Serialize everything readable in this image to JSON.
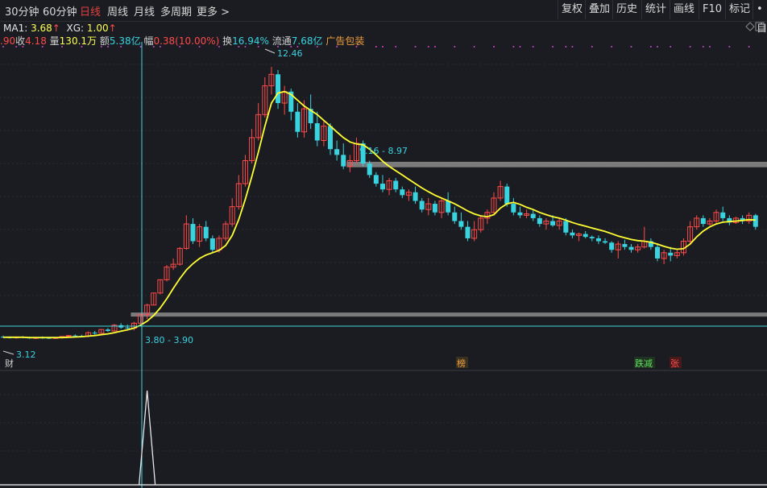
{
  "toolbar": {
    "periods": [
      "30分钟",
      "60分钟",
      "日线",
      "周线",
      "月线",
      "多周期",
      "更多 >"
    ],
    "active_period": "日线",
    "tools": [
      "复权",
      "叠加",
      "历史",
      "统计",
      "画线",
      "F10",
      "标记",
      "•自"
    ]
  },
  "indicator": {
    "ma_label": "MA1:",
    "ma_value": "3.68",
    "ma_arrow": "↑",
    "xg_label": "XG:",
    "xg_value": "1.00",
    "xg_arrow": "↑"
  },
  "quote": {
    "open_fragment": ".90",
    "close_label": "收",
    "close_value": "4.18",
    "volume_label": "量",
    "volume_value": "130.1万",
    "amount_label": "额",
    "amount_value": "5.38亿",
    "change_label": "幅",
    "change_value": "0.38(10.00%)",
    "turnover_label": "换",
    "turnover_value": "16.94%",
    "float_label": "流通",
    "float_value": "7.68亿",
    "ad_label": "广告包装"
  },
  "annotations": {
    "high_label": "12.46",
    "low_label": "3.12",
    "range_upper": "9.16 - 8.97",
    "range_lower": "3.80 - 3.90",
    "tag_cai": "财",
    "tag_bang": "榜",
    "tag_jianchi": "跌减",
    "tag_zhang": "张"
  },
  "colors": {
    "background": "#1b1c21",
    "up_candle": "#ff4a4a",
    "down_candle": "#39d3e0",
    "ma_line": "#ffff33",
    "range_band": "#8c8c8c",
    "crosshair": "#3fd6e0",
    "active_tab": "#e04040"
  },
  "chart_data": {
    "type": "candlestick",
    "indicator_line": "MA1",
    "price_range": [
      2.3,
      13.3
    ],
    "high": 12.46,
    "low": 3.12,
    "candles": [
      {
        "o": 3.08,
        "h": 3.12,
        "l": 3.03,
        "c": 3.06
      },
      {
        "o": 3.06,
        "h": 3.09,
        "l": 3.02,
        "c": 3.05
      },
      {
        "o": 3.05,
        "h": 3.09,
        "l": 3.01,
        "c": 3.07
      },
      {
        "o": 3.07,
        "h": 3.1,
        "l": 3.03,
        "c": 3.05
      },
      {
        "o": 3.05,
        "h": 3.08,
        "l": 3.01,
        "c": 3.03
      },
      {
        "o": 3.03,
        "h": 3.07,
        "l": 3.0,
        "c": 3.05
      },
      {
        "o": 3.05,
        "h": 3.09,
        "l": 3.01,
        "c": 3.04
      },
      {
        "o": 3.04,
        "h": 3.07,
        "l": 3.0,
        "c": 3.03
      },
      {
        "o": 3.03,
        "h": 3.06,
        "l": 3.0,
        "c": 3.05
      },
      {
        "o": 3.05,
        "h": 3.1,
        "l": 3.02,
        "c": 3.09
      },
      {
        "o": 3.09,
        "h": 3.14,
        "l": 3.05,
        "c": 3.12
      },
      {
        "o": 3.12,
        "h": 3.16,
        "l": 3.08,
        "c": 3.11
      },
      {
        "o": 3.11,
        "h": 3.15,
        "l": 3.06,
        "c": 3.1
      },
      {
        "o": 3.1,
        "h": 3.26,
        "l": 3.06,
        "c": 3.22
      },
      {
        "o": 3.22,
        "h": 3.28,
        "l": 3.15,
        "c": 3.2
      },
      {
        "o": 3.2,
        "h": 3.35,
        "l": 3.18,
        "c": 3.33
      },
      {
        "o": 3.33,
        "h": 3.38,
        "l": 3.25,
        "c": 3.28
      },
      {
        "o": 3.28,
        "h": 3.52,
        "l": 3.26,
        "c": 3.48
      },
      {
        "o": 3.48,
        "h": 3.55,
        "l": 3.35,
        "c": 3.4
      },
      {
        "o": 3.4,
        "h": 3.5,
        "l": 3.33,
        "c": 3.38
      },
      {
        "o": 3.38,
        "h": 3.6,
        "l": 3.3,
        "c": 3.55
      },
      {
        "o": 3.55,
        "h": 3.9,
        "l": 3.52,
        "c": 3.85
      },
      {
        "o": 3.85,
        "h": 4.23,
        "l": 3.7,
        "c": 4.18
      },
      {
        "o": 4.18,
        "h": 4.6,
        "l": 4.18,
        "c": 4.6
      },
      {
        "o": 4.6,
        "h": 5.06,
        "l": 4.55,
        "c": 5.06
      },
      {
        "o": 5.06,
        "h": 5.57,
        "l": 5.0,
        "c": 5.5
      },
      {
        "o": 5.5,
        "h": 5.8,
        "l": 5.4,
        "c": 5.6
      },
      {
        "o": 5.6,
        "h": 6.2,
        "l": 5.55,
        "c": 6.15
      },
      {
        "o": 6.15,
        "h": 7.3,
        "l": 6.1,
        "c": 7.0
      },
      {
        "o": 7.0,
        "h": 7.2,
        "l": 6.3,
        "c": 6.4
      },
      {
        "o": 6.4,
        "h": 7.0,
        "l": 6.2,
        "c": 6.9
      },
      {
        "o": 6.9,
        "h": 7.1,
        "l": 6.4,
        "c": 6.5
      },
      {
        "o": 6.5,
        "h": 6.6,
        "l": 6.0,
        "c": 6.1
      },
      {
        "o": 6.1,
        "h": 6.6,
        "l": 6.0,
        "c": 6.5
      },
      {
        "o": 6.5,
        "h": 7.1,
        "l": 6.4,
        "c": 7.0
      },
      {
        "o": 7.0,
        "h": 7.9,
        "l": 6.9,
        "c": 7.6
      },
      {
        "o": 7.6,
        "h": 8.7,
        "l": 7.5,
        "c": 8.4
      },
      {
        "o": 8.4,
        "h": 9.4,
        "l": 8.3,
        "c": 9.2
      },
      {
        "o": 9.2,
        "h": 10.3,
        "l": 9.1,
        "c": 10.0
      },
      {
        "o": 10.0,
        "h": 11.2,
        "l": 9.9,
        "c": 10.8
      },
      {
        "o": 10.8,
        "h": 12.1,
        "l": 10.7,
        "c": 11.8
      },
      {
        "o": 11.8,
        "h": 12.46,
        "l": 11.5,
        "c": 12.2
      },
      {
        "o": 12.2,
        "h": 12.35,
        "l": 11.0,
        "c": 11.2
      },
      {
        "o": 11.2,
        "h": 11.8,
        "l": 10.8,
        "c": 11.6
      },
      {
        "o": 11.6,
        "h": 11.7,
        "l": 10.6,
        "c": 10.9
      },
      {
        "o": 10.9,
        "h": 11.2,
        "l": 10.0,
        "c": 10.2
      },
      {
        "o": 10.2,
        "h": 11.3,
        "l": 10.0,
        "c": 11.0
      },
      {
        "o": 11.0,
        "h": 11.5,
        "l": 10.3,
        "c": 10.5
      },
      {
        "o": 10.5,
        "h": 10.9,
        "l": 9.7,
        "c": 9.9
      },
      {
        "o": 9.9,
        "h": 10.6,
        "l": 9.7,
        "c": 10.4
      },
      {
        "o": 10.4,
        "h": 10.5,
        "l": 9.4,
        "c": 9.6
      },
      {
        "o": 9.6,
        "h": 9.9,
        "l": 9.2,
        "c": 9.4
      },
      {
        "o": 9.4,
        "h": 9.8,
        "l": 8.9,
        "c": 9.0
      },
      {
        "o": 9.0,
        "h": 9.4,
        "l": 8.8,
        "c": 9.2
      },
      {
        "o": 9.2,
        "h": 10.0,
        "l": 9.1,
        "c": 9.8
      },
      {
        "o": 9.8,
        "h": 9.9,
        "l": 9.0,
        "c": 9.1
      },
      {
        "o": 9.1,
        "h": 9.2,
        "l": 8.6,
        "c": 8.7
      },
      {
        "o": 8.7,
        "h": 8.8,
        "l": 8.3,
        "c": 8.4
      },
      {
        "o": 8.4,
        "h": 8.7,
        "l": 8.1,
        "c": 8.2
      },
      {
        "o": 8.2,
        "h": 8.6,
        "l": 8.0,
        "c": 8.5
      },
      {
        "o": 8.5,
        "h": 8.6,
        "l": 8.1,
        "c": 8.2
      },
      {
        "o": 8.2,
        "h": 8.3,
        "l": 7.9,
        "c": 8.0
      },
      {
        "o": 8.0,
        "h": 8.2,
        "l": 7.8,
        "c": 8.1
      },
      {
        "o": 8.1,
        "h": 8.3,
        "l": 7.7,
        "c": 7.8
      },
      {
        "o": 7.8,
        "h": 7.9,
        "l": 7.4,
        "c": 7.5
      },
      {
        "o": 7.5,
        "h": 7.9,
        "l": 7.3,
        "c": 7.7
      },
      {
        "o": 7.7,
        "h": 7.8,
        "l": 7.3,
        "c": 7.4
      },
      {
        "o": 7.4,
        "h": 7.9,
        "l": 7.2,
        "c": 7.8
      },
      {
        "o": 7.8,
        "h": 8.1,
        "l": 7.3,
        "c": 7.4
      },
      {
        "o": 7.4,
        "h": 7.6,
        "l": 7.0,
        "c": 7.1
      },
      {
        "o": 7.1,
        "h": 7.4,
        "l": 6.8,
        "c": 6.9
      },
      {
        "o": 6.9,
        "h": 7.1,
        "l": 6.4,
        "c": 6.5
      },
      {
        "o": 6.5,
        "h": 7.1,
        "l": 6.4,
        "c": 6.8
      },
      {
        "o": 6.8,
        "h": 7.3,
        "l": 6.7,
        "c": 7.2
      },
      {
        "o": 7.2,
        "h": 7.5,
        "l": 7.0,
        "c": 7.4
      },
      {
        "o": 7.4,
        "h": 8.1,
        "l": 7.3,
        "c": 7.9
      },
      {
        "o": 7.9,
        "h": 8.5,
        "l": 7.8,
        "c": 8.3
      },
      {
        "o": 8.3,
        "h": 8.4,
        "l": 7.6,
        "c": 7.7
      },
      {
        "o": 7.7,
        "h": 7.9,
        "l": 7.3,
        "c": 7.4
      },
      {
        "o": 7.4,
        "h": 7.6,
        "l": 7.2,
        "c": 7.3
      },
      {
        "o": 7.3,
        "h": 7.5,
        "l": 7.2,
        "c": 7.35
      },
      {
        "o": 7.35,
        "h": 7.5,
        "l": 7.1,
        "c": 7.2
      },
      {
        "o": 7.2,
        "h": 7.3,
        "l": 6.9,
        "c": 7.0
      },
      {
        "o": 7.0,
        "h": 7.2,
        "l": 6.8,
        "c": 7.1
      },
      {
        "o": 7.1,
        "h": 7.3,
        "l": 6.9,
        "c": 6.95
      },
      {
        "o": 6.95,
        "h": 7.2,
        "l": 6.8,
        "c": 7.1
      },
      {
        "o": 7.1,
        "h": 7.2,
        "l": 6.6,
        "c": 6.7
      },
      {
        "o": 6.7,
        "h": 6.8,
        "l": 6.5,
        "c": 6.6
      },
      {
        "o": 6.6,
        "h": 6.7,
        "l": 6.4,
        "c": 6.65
      },
      {
        "o": 6.65,
        "h": 6.75,
        "l": 6.5,
        "c": 6.55
      },
      {
        "o": 6.55,
        "h": 6.6,
        "l": 6.4,
        "c": 6.5
      },
      {
        "o": 6.5,
        "h": 6.6,
        "l": 6.3,
        "c": 6.4
      },
      {
        "o": 6.4,
        "h": 6.5,
        "l": 6.3,
        "c": 6.35
      },
      {
        "o": 6.35,
        "h": 6.4,
        "l": 6.0,
        "c": 6.1
      },
      {
        "o": 6.1,
        "h": 6.4,
        "l": 5.8,
        "c": 6.3
      },
      {
        "o": 6.3,
        "h": 6.45,
        "l": 6.1,
        "c": 6.2
      },
      {
        "o": 6.2,
        "h": 6.3,
        "l": 6.0,
        "c": 6.1
      },
      {
        "o": 6.1,
        "h": 6.3,
        "l": 6.0,
        "c": 6.2
      },
      {
        "o": 6.2,
        "h": 6.9,
        "l": 6.15,
        "c": 6.4
      },
      {
        "o": 6.4,
        "h": 6.5,
        "l": 6.1,
        "c": 6.2
      },
      {
        "o": 6.2,
        "h": 6.3,
        "l": 5.7,
        "c": 5.8
      },
      {
        "o": 5.8,
        "h": 6.1,
        "l": 5.6,
        "c": 6.0
      },
      {
        "o": 6.0,
        "h": 6.2,
        "l": 5.7,
        "c": 5.9
      },
      {
        "o": 5.9,
        "h": 6.1,
        "l": 5.8,
        "c": 6.0
      },
      {
        "o": 6.0,
        "h": 6.5,
        "l": 5.9,
        "c": 6.4
      },
      {
        "o": 6.4,
        "h": 7.1,
        "l": 6.3,
        "c": 6.9
      },
      {
        "o": 6.9,
        "h": 7.3,
        "l": 6.8,
        "c": 7.2
      },
      {
        "o": 7.2,
        "h": 7.3,
        "l": 6.9,
        "c": 7.0
      },
      {
        "o": 7.0,
        "h": 7.2,
        "l": 6.95,
        "c": 7.1
      },
      {
        "o": 7.1,
        "h": 7.5,
        "l": 7.0,
        "c": 7.4
      },
      {
        "o": 7.4,
        "h": 7.6,
        "l": 7.1,
        "c": 7.2
      },
      {
        "o": 7.2,
        "h": 7.3,
        "l": 6.95,
        "c": 7.05
      },
      {
        "o": 7.05,
        "h": 7.25,
        "l": 7.0,
        "c": 7.2
      },
      {
        "o": 7.2,
        "h": 7.3,
        "l": 7.0,
        "c": 7.1
      },
      {
        "o": 7.1,
        "h": 7.4,
        "l": 7.0,
        "c": 7.3
      },
      {
        "o": 7.3,
        "h": 7.35,
        "l": 6.8,
        "c": 6.9
      }
    ],
    "ma": [
      3.06,
      3.06,
      3.06,
      3.06,
      3.05,
      3.05,
      3.05,
      3.05,
      3.05,
      3.05,
      3.06,
      3.07,
      3.08,
      3.1,
      3.12,
      3.15,
      3.18,
      3.22,
      3.27,
      3.32,
      3.38,
      3.48,
      3.62,
      3.82,
      4.08,
      4.4,
      4.76,
      5.1,
      5.4,
      5.62,
      5.8,
      5.92,
      6.0,
      6.08,
      6.25,
      6.6,
      7.15,
      7.85,
      8.65,
      9.5,
      10.4,
      11.2,
      11.55,
      11.6,
      11.5,
      11.3,
      11.1,
      10.95,
      10.8,
      10.6,
      10.4,
      10.2,
      10.0,
      9.85,
      9.78,
      9.75,
      9.6,
      9.4,
      9.18,
      9.0,
      8.85,
      8.7,
      8.55,
      8.4,
      8.25,
      8.12,
      8.0,
      7.9,
      7.8,
      7.7,
      7.58,
      7.45,
      7.35,
      7.28,
      7.25,
      7.32,
      7.55,
      7.7,
      7.75,
      7.68,
      7.58,
      7.5,
      7.4,
      7.32,
      7.25,
      7.2,
      7.13,
      7.05,
      6.98,
      6.92,
      6.86,
      6.8,
      6.74,
      6.66,
      6.58,
      6.52,
      6.46,
      6.42,
      6.4,
      6.36,
      6.3,
      6.22,
      6.16,
      6.12,
      6.14,
      6.3,
      6.55,
      6.75,
      6.9,
      7.0,
      7.06,
      7.08,
      7.1,
      7.12,
      7.15,
      7.13
    ],
    "range_bands": [
      {
        "label": "9.16 - 8.97",
        "upper": 9.16,
        "lower": 8.97,
        "start_index": 53
      },
      {
        "label": "3.80 - 3.90",
        "upper": 3.9,
        "lower": 3.8,
        "start_index": 20
      }
    ],
    "signal_index": 22,
    "signal_range": [
      0,
      1
    ],
    "signal_value": 1.0
  }
}
